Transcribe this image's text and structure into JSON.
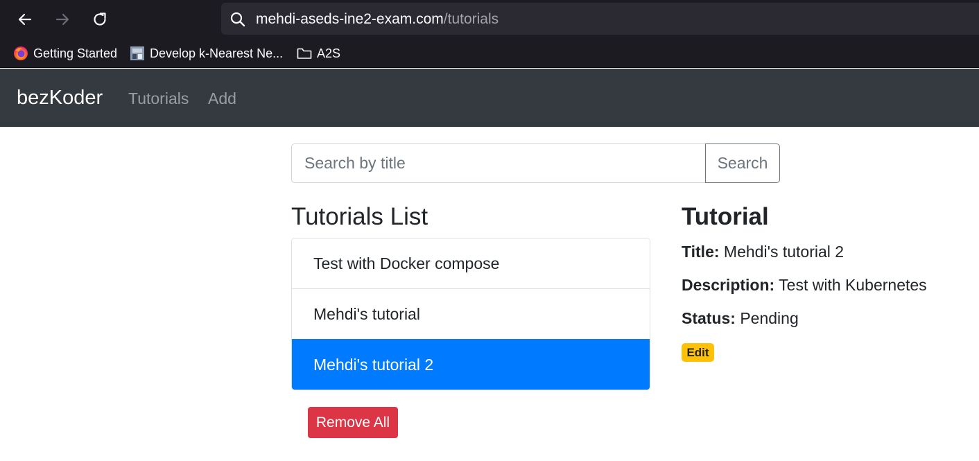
{
  "browser": {
    "url_host": "mehdi-aseds-ine2-exam.com",
    "url_path": "/tutorials",
    "bookmarks": [
      {
        "label": "Getting Started",
        "icon": "firefox-icon"
      },
      {
        "label": "Develop k-Nearest Ne...",
        "icon": "page-thumbnail-icon"
      },
      {
        "label": "A2S",
        "icon": "folder-icon"
      }
    ]
  },
  "navbar": {
    "brand": "bezKoder",
    "links": [
      "Tutorials",
      "Add"
    ]
  },
  "search": {
    "placeholder": "Search by title",
    "button_label": "Search"
  },
  "list": {
    "title": "Tutorials List",
    "items": [
      "Test with Docker compose",
      "Mehdi's tutorial",
      "Mehdi's tutorial 2"
    ],
    "active_index": 2,
    "remove_all_label": "Remove All"
  },
  "detail": {
    "heading": "Tutorial",
    "title_label": "Title:",
    "title_value": "Mehdi's tutorial 2",
    "description_label": "Description:",
    "description_value": "Test with Kubernetes",
    "status_label": "Status:",
    "status_value": "Pending",
    "edit_label": "Edit"
  },
  "colors": {
    "active": "#007bff",
    "danger": "#dc3545",
    "warning": "#ffc107",
    "navbar": "#343a40"
  }
}
